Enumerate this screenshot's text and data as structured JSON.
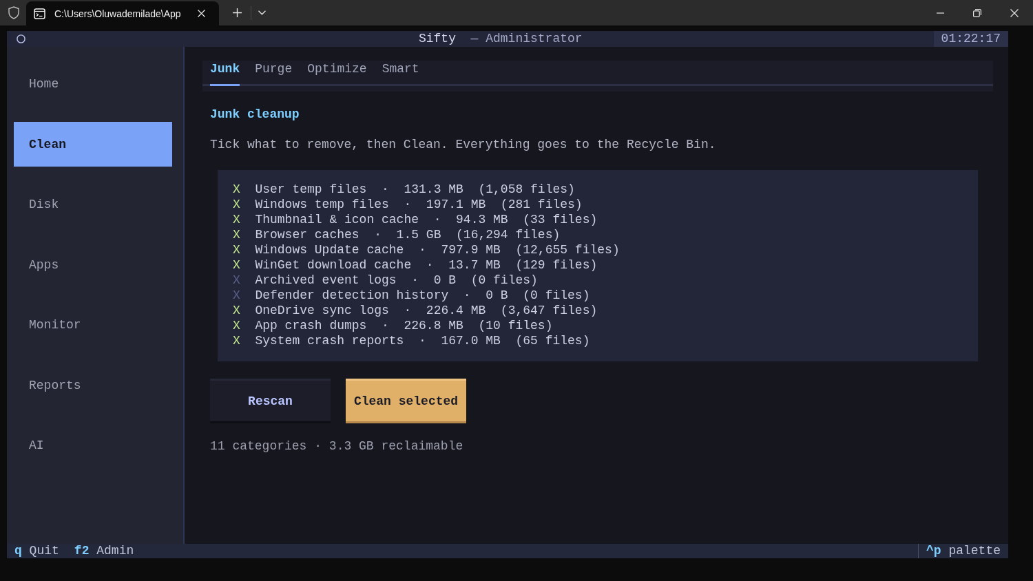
{
  "browser": {
    "tab": {
      "title": "C:\\Users\\Oluwademilade\\App"
    }
  },
  "header": {
    "title": "Sifty",
    "subtitle": "— Administrator",
    "clock": "01:22:17"
  },
  "sidebar": {
    "items": [
      {
        "label": "Home",
        "selected": false
      },
      {
        "label": "Clean",
        "selected": true
      },
      {
        "label": "Disk",
        "selected": false
      },
      {
        "label": "Apps",
        "selected": false
      },
      {
        "label": "Monitor",
        "selected": false
      },
      {
        "label": "Reports",
        "selected": false
      },
      {
        "label": "AI",
        "selected": false
      }
    ]
  },
  "tabs": [
    {
      "label": "Junk",
      "selected": true
    },
    {
      "label": "Purge",
      "selected": false
    },
    {
      "label": "Optimize",
      "selected": false
    },
    {
      "label": "Smart",
      "selected": false
    }
  ],
  "section": {
    "heading": "Junk cleanup",
    "description": "Tick what to remove, then Clean. Everything goes to the Recycle Bin."
  },
  "items": [
    {
      "mark": "X",
      "checked": true,
      "label": "User temp files  ·  131.3 MB  (1,058 files)"
    },
    {
      "mark": "X",
      "checked": true,
      "label": "Windows temp files  ·  197.1 MB  (281 files)"
    },
    {
      "mark": "X",
      "checked": true,
      "label": "Thumbnail & icon cache  ·  94.3 MB  (33 files)"
    },
    {
      "mark": "X",
      "checked": true,
      "label": "Browser caches  ·  1.5 GB  (16,294 files)"
    },
    {
      "mark": "X",
      "checked": true,
      "label": "Windows Update cache  ·  797.9 MB  (12,655 files)"
    },
    {
      "mark": "X",
      "checked": true,
      "label": "WinGet download cache  ·  13.7 MB  (129 files)"
    },
    {
      "mark": "X",
      "checked": false,
      "label": "Archived event logs  ·  0 B  (0 files)"
    },
    {
      "mark": "X",
      "checked": false,
      "label": "Defender detection history  ·  0 B  (0 files)"
    },
    {
      "mark": "X",
      "checked": true,
      "label": "OneDrive sync logs  ·  226.4 MB  (3,647 files)"
    },
    {
      "mark": "X",
      "checked": true,
      "label": "App crash dumps  ·  226.8 MB  (10 files)"
    },
    {
      "mark": "X",
      "checked": true,
      "label": "System crash reports  ·  167.0 MB  (65 files)"
    }
  ],
  "buttons": [
    {
      "label": "Rescan",
      "kind": "default"
    },
    {
      "label": "Clean selected",
      "kind": "primary"
    }
  ],
  "summary": "11 categories · 3.3 GB reclaimable",
  "footer": {
    "bindings": [
      {
        "key": "q",
        "label": "Quit"
      },
      {
        "key": "f2",
        "label": "Admin"
      }
    ],
    "palette": {
      "key": "^p",
      "label": "palette"
    }
  }
}
